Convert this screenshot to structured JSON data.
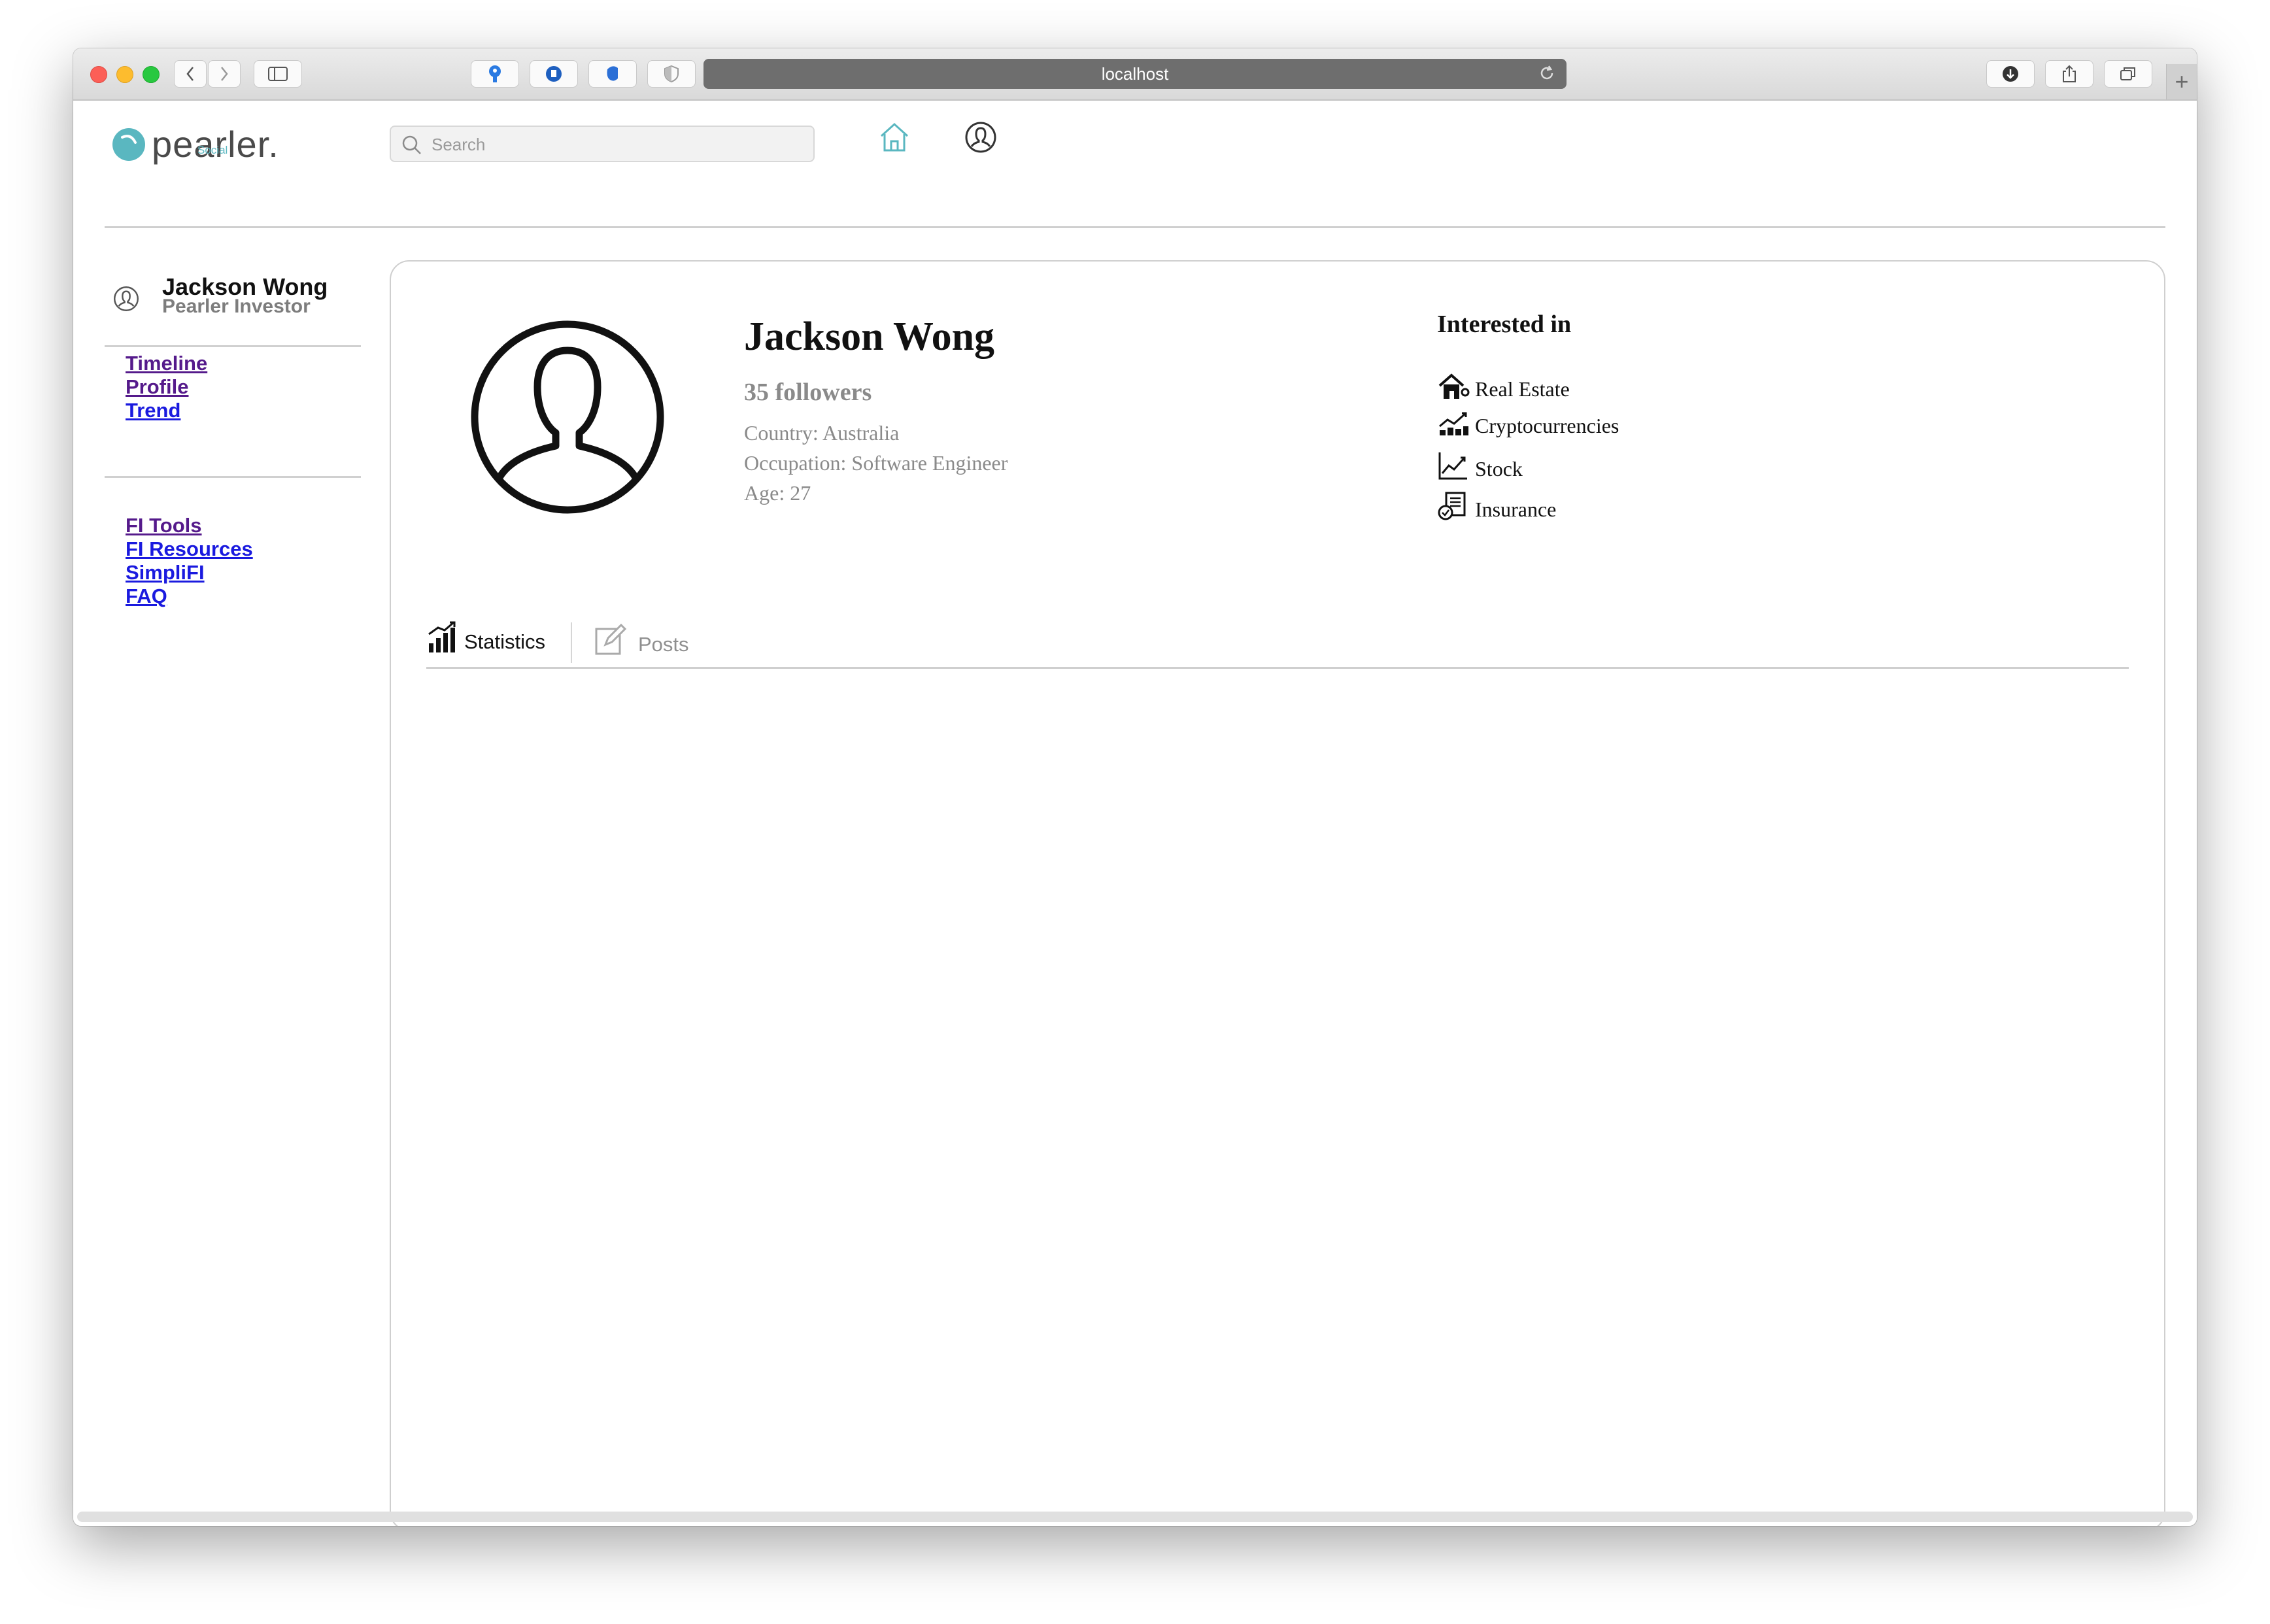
{
  "browser": {
    "url": "localhost",
    "new_tab_label": "+"
  },
  "header": {
    "logo_text": "pearler.",
    "logo_subtitle": "Social",
    "search_placeholder": "Search",
    "accent_color": "#5ab7c0"
  },
  "sidebar": {
    "user_name": "Jackson Wong",
    "user_role": "Pearler Investor",
    "nav_links": [
      "Timeline",
      "Profile",
      "Trend"
    ],
    "resource_links": [
      "FI Tools",
      "FI Resources",
      "SimpliFI",
      "FAQ"
    ]
  },
  "profile": {
    "name": "Jackson Wong",
    "followers": "35 followers",
    "country": "Country: Australia",
    "occupation": "Occupation: Software Engineer",
    "age": "Age: 27"
  },
  "interests": {
    "title": "Interested in",
    "items": [
      {
        "label": "Real Estate",
        "icon": "house-icon"
      },
      {
        "label": "Cryptocurrencies",
        "icon": "crypto-chart-icon"
      },
      {
        "label": "Stock",
        "icon": "line-chart-icon"
      },
      {
        "label": "Insurance",
        "icon": "insurance-document-icon"
      }
    ]
  },
  "tabs": {
    "statistics": "Statistics",
    "posts": "Posts",
    "active": "Statistics"
  }
}
